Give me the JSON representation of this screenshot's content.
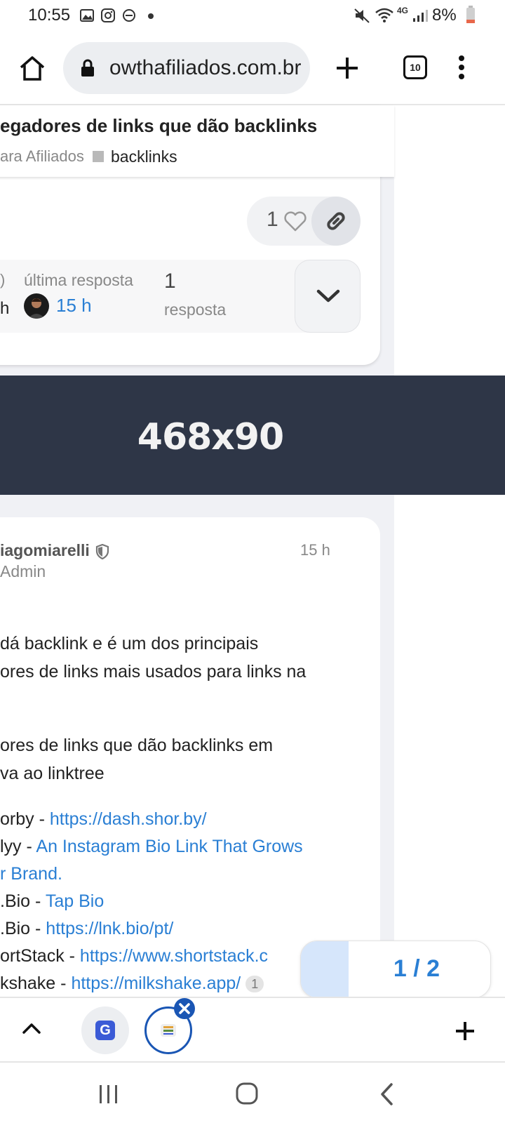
{
  "status_bar": {
    "time": "10:55",
    "battery": "8%",
    "network": "4G"
  },
  "browser": {
    "url": "owthafiliados.com.br",
    "tab_count": "10"
  },
  "topic": {
    "title": "egadores de links que dão backlinks",
    "category": "ara Afiliados",
    "tag": "backlinks",
    "like_count": "1",
    "stat_left_top": ")",
    "stat_left_bottom": "h",
    "last_reply_label": "última resposta",
    "last_reply_time": "15 h",
    "replies_count": "1",
    "replies_label": "resposta"
  },
  "ad": {
    "text": "468x90"
  },
  "post": {
    "author": "iagomiarelli",
    "role": "Admin",
    "time": "15 h",
    "p1_line1": "dá backlink e é um dos principais",
    "p1_line2": "ores de links mais usados para links na",
    "p2_line1": "ores de links que dão backlinks em",
    "p2_line2": "va ao linktree",
    "items": [
      {
        "prefix": "orby - ",
        "link": "https://dash.shor.by/"
      },
      {
        "prefix": "lyy - ",
        "link": "An Instagram Bio Link That Grows"
      },
      {
        "prefix": "",
        "link": "r Brand."
      },
      {
        "prefix": ".Bio - ",
        "link": "Tap Bio"
      },
      {
        "prefix": ".Bio - ",
        "link": "https://lnk.bio/pt/"
      },
      {
        "prefix": "ortStack - ",
        "link": "https://www.shortstack.c"
      },
      {
        "prefix": "kshake - ",
        "link": "https://milkshake.app/"
      }
    ],
    "item_badge": "1"
  },
  "pager": {
    "text": "1 / 2",
    "progress": 0.5
  },
  "colors": {
    "link": "#2a7fd4",
    "ad_bg": "#2e3647",
    "accent_tab": "#1a56b4"
  }
}
